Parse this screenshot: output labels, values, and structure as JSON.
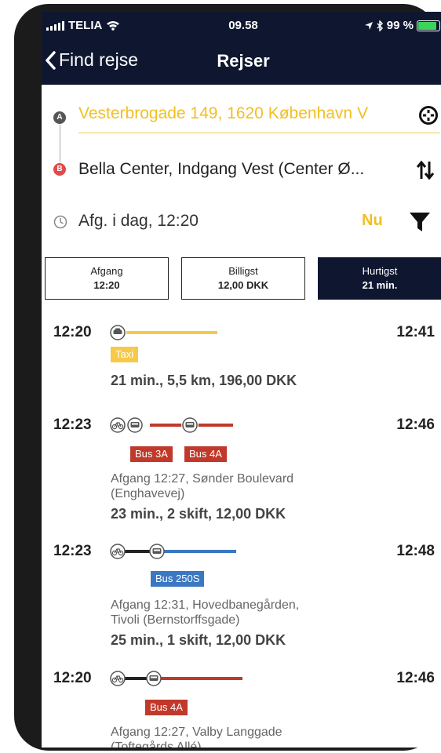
{
  "status": {
    "carrier": "TELIA",
    "time": "09.58",
    "battery": "99 %"
  },
  "nav": {
    "back_label": "Find rejse",
    "title": "Rejser"
  },
  "route": {
    "from_marker": "A",
    "to_marker": "B",
    "from": "Vesterbrogade 149, 1620 København V",
    "to": "Bella Center, Indgang Vest (Center Ø...",
    "departure": "Afg. i dag, 12:20",
    "now_label": "Nu"
  },
  "tabs": [
    {
      "label": "Afgang",
      "value": "12:20"
    },
    {
      "label": "Billigst",
      "value": "12,00 DKK"
    },
    {
      "label": "Hurtigst",
      "value": "21 min."
    }
  ],
  "journeys": [
    {
      "dep": "12:20",
      "arr": "12:41",
      "badges": [
        {
          "text": "Taxi",
          "color": "#f7c948"
        }
      ],
      "desc": [],
      "summary": "21 min.,  5,5 km,  196,00 DKK"
    },
    {
      "dep": "12:23",
      "arr": "12:46",
      "badges": [
        {
          "text": "Bus 3A",
          "color": "#c0392b"
        },
        {
          "text": "Bus 4A",
          "color": "#c0392b"
        }
      ],
      "desc": [
        "Afgang 12:27, Sønder Boulevard",
        "(Enghavevej)"
      ],
      "summary": "23 min.,  2 skift,  12,00 DKK"
    },
    {
      "dep": "12:23",
      "arr": "12:48",
      "badges": [
        {
          "text": "Bus 250S",
          "color": "#3a78c2"
        }
      ],
      "desc": [
        "Afgang 12:31, Hovedbanegården,",
        "Tivoli (Bernstorffsgade)"
      ],
      "summary": "25 min.,  1 skift,  12,00 DKK"
    },
    {
      "dep": "12:20",
      "arr": "12:46",
      "badges": [
        {
          "text": "Bus 4A",
          "color": "#c0392b"
        }
      ],
      "desc": [
        "Afgang 12:27, Valby Langgade",
        "(Toftegårds Allé)"
      ],
      "summary": ""
    }
  ],
  "colors": {
    "navy": "#0f1730",
    "accent_yellow": "#f2bf22",
    "bus_red": "#c0392b",
    "bus_blue": "#3a78c2",
    "walk": "#222222"
  },
  "icons": [
    "back-chevron-icon",
    "wifi-icon",
    "location-arrow-icon",
    "bluetooth-icon",
    "battery-icon",
    "locate-crosshair-icon",
    "swap-arrows-icon",
    "clock-icon",
    "filter-icon",
    "taxi-icon",
    "bicycle-icon",
    "bus-icon"
  ]
}
